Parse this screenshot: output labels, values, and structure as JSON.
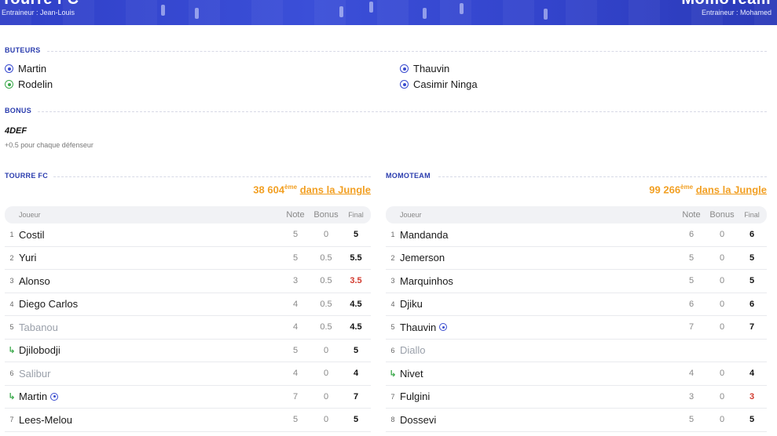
{
  "header": {
    "home_team": "Tourre FC",
    "home_coach": "Entraineur : Jean-Louis",
    "away_team": "MomoTeam",
    "away_coach": "Entraineur : Mohamed"
  },
  "scorers": {
    "title": "BUTEURS",
    "home": [
      {
        "name": "Martin",
        "icon": "ball-icon",
        "color": "#3a4ccf"
      },
      {
        "name": "Rodelin",
        "icon": "ball-icon",
        "color": "#3aa84a"
      }
    ],
    "away": [
      {
        "name": "Thauvin",
        "icon": "ball-icon",
        "color": "#3a4ccf"
      },
      {
        "name": "Casimir Ninga",
        "icon": "ball-icon",
        "color": "#3a4ccf"
      }
    ]
  },
  "bonus": {
    "title": "BONUS",
    "name": "4DEF",
    "description": "+0.5 pour chaque défenseur"
  },
  "home_table": {
    "title": "TOURRE FC",
    "rank_number": "38 604",
    "rank_suffix": "ème",
    "rank_link": "dans la Jungle",
    "headers": {
      "player": "Joueur",
      "note": "Note",
      "bonus": "Bonus",
      "final": "Final"
    },
    "rows": [
      {
        "num": "1",
        "name": "Costil",
        "note": "5",
        "bonus": "0",
        "final": "5"
      },
      {
        "num": "2",
        "name": "Yuri",
        "note": "5",
        "bonus": "0.5",
        "final": "5.5"
      },
      {
        "num": "3",
        "name": "Alonso",
        "note": "3",
        "bonus": "0.5",
        "final": "3.5"
      },
      {
        "num": "4",
        "name": "Diego Carlos",
        "note": "4",
        "bonus": "0.5",
        "final": "4.5"
      },
      {
        "num": "5",
        "name": "Tabanou",
        "note": "4",
        "bonus": "0.5",
        "final": "4.5"
      },
      {
        "num": "",
        "name": "Djilobodji",
        "note": "5",
        "bonus": "0",
        "final": "5"
      },
      {
        "num": "6",
        "name": "Salibur",
        "note": "4",
        "bonus": "0",
        "final": "4"
      },
      {
        "num": "",
        "name": "Martin",
        "note": "7",
        "bonus": "0",
        "final": "7"
      },
      {
        "num": "7",
        "name": "Lees-Melou",
        "note": "5",
        "bonus": "0",
        "final": "5"
      }
    ]
  },
  "away_table": {
    "title": "MOMOTEAM",
    "rank_number": "99 266",
    "rank_suffix": "ème",
    "rank_link": "dans la Jungle",
    "headers": {
      "player": "Joueur",
      "note": "Note",
      "bonus": "Bonus",
      "final": "Final"
    },
    "rows": [
      {
        "num": "1",
        "name": "Mandanda",
        "note": "6",
        "bonus": "0",
        "final": "6"
      },
      {
        "num": "2",
        "name": "Jemerson",
        "note": "5",
        "bonus": "0",
        "final": "5"
      },
      {
        "num": "3",
        "name": "Marquinhos",
        "note": "5",
        "bonus": "0",
        "final": "5"
      },
      {
        "num": "4",
        "name": "Djiku",
        "note": "6",
        "bonus": "0",
        "final": "6"
      },
      {
        "num": "5",
        "name": "Thauvin",
        "note": "7",
        "bonus": "0",
        "final": "7"
      },
      {
        "num": "6",
        "name": "Diallo",
        "note": "",
        "bonus": "",
        "final": ""
      },
      {
        "num": "",
        "name": "Nivet",
        "note": "4",
        "bonus": "0",
        "final": "4"
      },
      {
        "num": "7",
        "name": "Fulgini",
        "note": "3",
        "bonus": "0",
        "final": "3"
      },
      {
        "num": "8",
        "name": "Dossevi",
        "note": "5",
        "bonus": "0",
        "final": "5"
      }
    ]
  },
  "colors": {
    "accent": "#2a3cae",
    "rank": "#f2a024",
    "bad_score": "#d23a2e",
    "substitution": "#3aa84a"
  }
}
